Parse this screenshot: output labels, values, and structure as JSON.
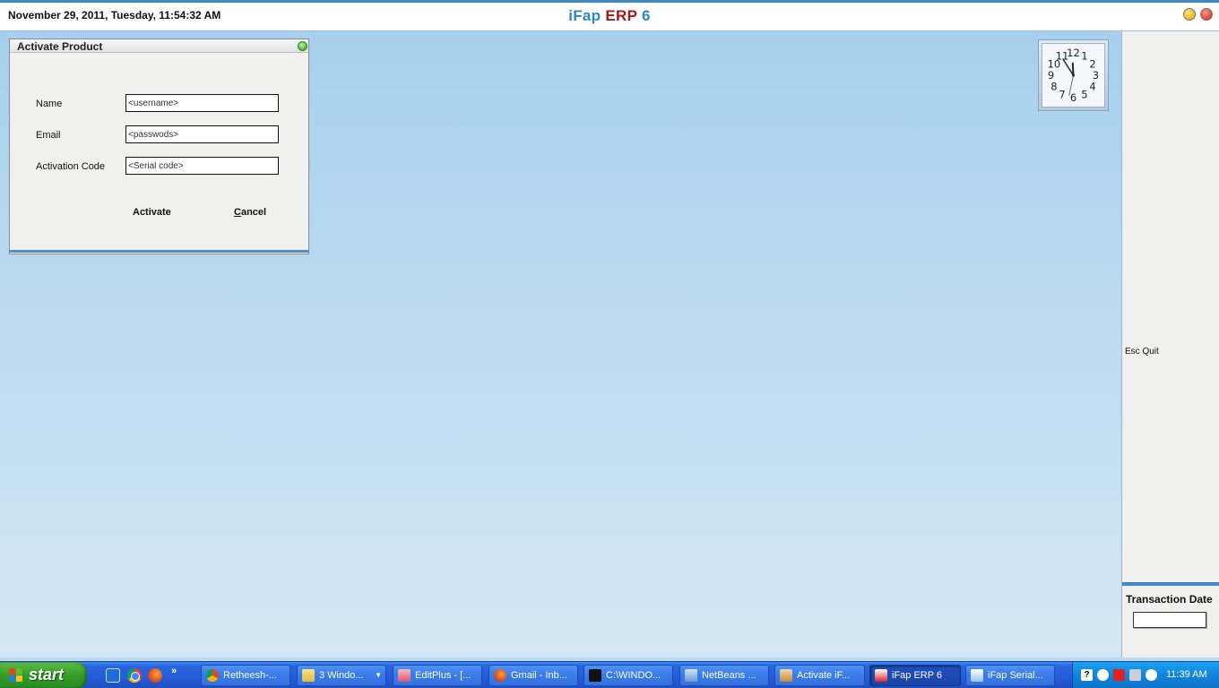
{
  "header": {
    "datetime": "November  29, 2011, Tuesday, 11:54:32 AM",
    "title_part1": "iFap",
    "title_part2": "ERP",
    "title_part3": "6"
  },
  "dialog": {
    "title": "Activate Product",
    "fields": [
      {
        "label": "Name",
        "value": "<username>"
      },
      {
        "label": "Email",
        "value": "<passwods>"
      },
      {
        "label": "Activation Code",
        "value": "<Serial code>"
      }
    ],
    "activate_label": "Activate",
    "cancel_first": "C",
    "cancel_rest": "ancel"
  },
  "right_panel": {
    "esc_quit": "Esc Quit",
    "transaction_date_label": "Transaction Date",
    "transaction_date_value": ""
  },
  "clock_widget": {
    "hour": 11,
    "minute": 54,
    "second": 32,
    "numerals": [
      "12",
      "1",
      "2",
      "3",
      "4",
      "5",
      "6",
      "7",
      "8",
      "9",
      "10",
      "11"
    ]
  },
  "taskbar": {
    "start_label": "start",
    "quick_launch_more": "»",
    "tasks": [
      {
        "label": "Retheesh-...",
        "icon": "chrome-icon",
        "active": false
      },
      {
        "label": "3 Windo...",
        "icon": "folder-icon",
        "active": false
      },
      {
        "label": "EditPlus - [...",
        "icon": "editplus-icon",
        "active": false
      },
      {
        "label": "Gmail - Inb...",
        "icon": "firefox-icon",
        "active": false
      },
      {
        "label": "C:\\WINDO...",
        "icon": "cmd-icon",
        "active": false
      },
      {
        "label": "NetBeans ...",
        "icon": "netbeans-icon",
        "active": false
      },
      {
        "label": "Activate iF...",
        "icon": "java-icon",
        "active": false
      },
      {
        "label": "iFap ERP 6",
        "icon": "ifap-icon",
        "active": true
      },
      {
        "label": "iFap Serial...",
        "icon": "document-icon",
        "active": false
      }
    ],
    "tray_help": "?",
    "clock": "11:39 AM"
  },
  "colors": {
    "accent_blue": "#2a87c6",
    "erp_red": "#a01818",
    "taskbar_blue": "#245dd7",
    "start_green": "#319c27"
  }
}
